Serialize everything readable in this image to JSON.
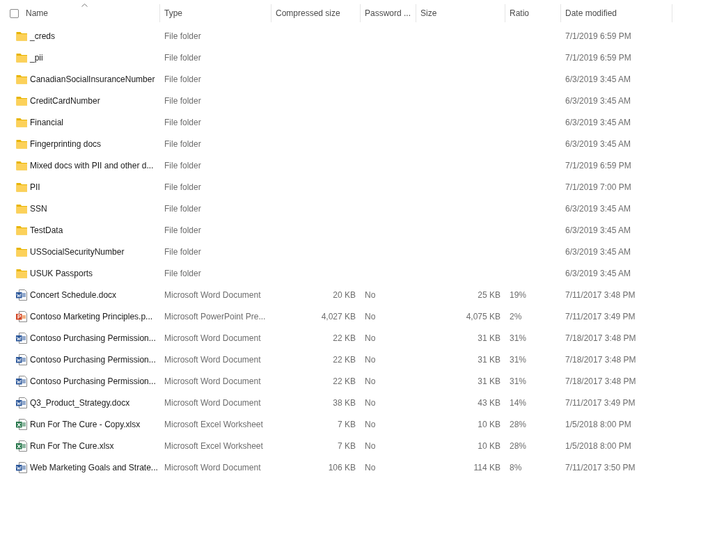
{
  "header": {
    "select_all": {
      "checked": false
    },
    "columns": [
      {
        "label": "Name",
        "sorted": true
      },
      {
        "label": "Type",
        "sorted": false
      },
      {
        "label": "Compressed size",
        "sorted": false
      },
      {
        "label": "Password ...",
        "sorted": false
      },
      {
        "label": "Size",
        "sorted": false
      },
      {
        "label": "Ratio",
        "sorted": false
      },
      {
        "label": "Date modified",
        "sorted": false
      }
    ]
  },
  "rows": [
    {
      "kind": "folder",
      "name": "_creds",
      "type": "File folder",
      "date": "7/1/2019 6:59 PM"
    },
    {
      "kind": "folder",
      "name": "_pii",
      "type": "File folder",
      "date": "7/1/2019 6:59 PM"
    },
    {
      "kind": "folder",
      "name": "CanadianSocialInsuranceNumber",
      "type": "File folder",
      "date": "6/3/2019 3:45 AM"
    },
    {
      "kind": "folder",
      "name": "CreditCardNumber",
      "type": "File folder",
      "date": "6/3/2019 3:45 AM"
    },
    {
      "kind": "folder",
      "name": "Financial",
      "type": "File folder",
      "date": "6/3/2019 3:45 AM"
    },
    {
      "kind": "folder",
      "name": "Fingerprinting docs",
      "type": "File folder",
      "date": "6/3/2019 3:45 AM"
    },
    {
      "kind": "folder",
      "name": "Mixed docs with PII and other d...",
      "type": "File folder",
      "date": "7/1/2019 6:59 PM"
    },
    {
      "kind": "folder",
      "name": "PII",
      "type": "File folder",
      "date": "7/1/2019 7:00 PM"
    },
    {
      "kind": "folder",
      "name": "SSN",
      "type": "File folder",
      "date": "6/3/2019 3:45 AM"
    },
    {
      "kind": "folder",
      "name": "TestData",
      "type": "File folder",
      "date": "6/3/2019 3:45 AM"
    },
    {
      "kind": "folder",
      "name": "USSocialSecurityNumber",
      "type": "File folder",
      "date": "6/3/2019 3:45 AM"
    },
    {
      "kind": "folder",
      "name": "USUK Passports",
      "type": "File folder",
      "date": "6/3/2019 3:45 AM"
    },
    {
      "kind": "word",
      "name": "Concert Schedule.docx",
      "type": "Microsoft Word Document",
      "compressed_size": "20 KB",
      "password": "No",
      "size": "25 KB",
      "ratio": "19%",
      "date": "7/11/2017 3:48 PM"
    },
    {
      "kind": "powerpoint",
      "name": "Contoso Marketing Principles.p...",
      "type": "Microsoft PowerPoint Pre...",
      "compressed_size": "4,027 KB",
      "password": "No",
      "size": "4,075 KB",
      "ratio": "2%",
      "date": "7/11/2017 3:49 PM"
    },
    {
      "kind": "word",
      "name": "Contoso Purchasing Permission...",
      "type": "Microsoft Word Document",
      "compressed_size": "22 KB",
      "password": "No",
      "size": "31 KB",
      "ratio": "31%",
      "date": "7/18/2017 3:48 PM"
    },
    {
      "kind": "word",
      "name": "Contoso Purchasing Permission...",
      "type": "Microsoft Word Document",
      "compressed_size": "22 KB",
      "password": "No",
      "size": "31 KB",
      "ratio": "31%",
      "date": "7/18/2017 3:48 PM"
    },
    {
      "kind": "word",
      "name": "Contoso Purchasing Permission...",
      "type": "Microsoft Word Document",
      "compressed_size": "22 KB",
      "password": "No",
      "size": "31 KB",
      "ratio": "31%",
      "date": "7/18/2017 3:48 PM"
    },
    {
      "kind": "word",
      "name": "Q3_Product_Strategy.docx",
      "type": "Microsoft Word Document",
      "compressed_size": "38 KB",
      "password": "No",
      "size": "43 KB",
      "ratio": "14%",
      "date": "7/11/2017 3:49 PM"
    },
    {
      "kind": "excel",
      "name": "Run For The Cure - Copy.xlsx",
      "type": "Microsoft Excel Worksheet",
      "compressed_size": "7 KB",
      "password": "No",
      "size": "10 KB",
      "ratio": "28%",
      "date": "1/5/2018 8:00 PM"
    },
    {
      "kind": "excel",
      "name": "Run For The Cure.xlsx",
      "type": "Microsoft Excel Worksheet",
      "compressed_size": "7 KB",
      "password": "No",
      "size": "10 KB",
      "ratio": "28%",
      "date": "1/5/2018 8:00 PM"
    },
    {
      "kind": "word",
      "name": "Web Marketing Goals and Strate...",
      "type": "Microsoft Word Document",
      "compressed_size": "106 KB",
      "password": "No",
      "size": "114 KB",
      "ratio": "8%",
      "date": "7/11/2017 3:50 PM"
    }
  ]
}
